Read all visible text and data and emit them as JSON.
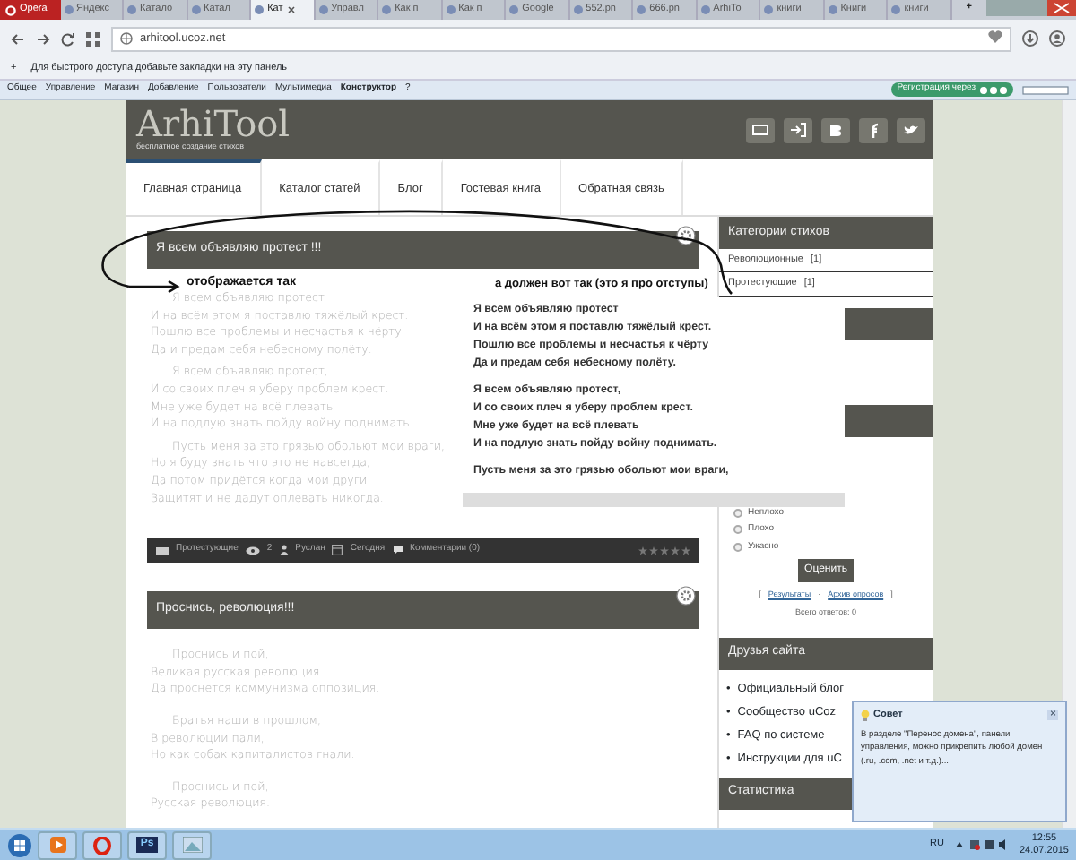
{
  "browser": {
    "menu_label": "Opera",
    "tabs": [
      {
        "label": "Яндекс",
        "selected": false
      },
      {
        "label": "Катало",
        "selected": false
      },
      {
        "label": "Катал",
        "selected": false
      },
      {
        "label": "Кат",
        "selected": true
      },
      {
        "label": "Управл",
        "selected": false
      },
      {
        "label": "Как п",
        "selected": false
      },
      {
        "label": "Как п",
        "selected": false
      },
      {
        "label": "Google",
        "selected": false
      },
      {
        "label": "552.pn",
        "selected": false
      },
      {
        "label": "666.pn",
        "selected": false
      },
      {
        "label": "ArhiTo",
        "selected": false
      },
      {
        "label": "книги",
        "selected": false
      },
      {
        "label": "Книги",
        "selected": false
      },
      {
        "label": "книги",
        "selected": false
      }
    ],
    "new_tab": "+",
    "address": "arhitool.ucoz.net",
    "bookmarks_add": "+",
    "bookmarks_hint": "Для быстрого доступа добавьте закладки на эту панель"
  },
  "admin_bar": {
    "items": [
      {
        "label": "Общее",
        "bold": false
      },
      {
        "label": "Управление",
        "bold": false
      },
      {
        "label": "Магазин",
        "bold": false
      },
      {
        "label": "Добавление",
        "bold": false
      },
      {
        "label": "Пользователи",
        "bold": false
      },
      {
        "label": "Мультимедиа",
        "bold": false
      },
      {
        "label": "Конструктор",
        "bold": true
      },
      {
        "label": "?",
        "bold": false
      }
    ],
    "register": "Регистрация через"
  },
  "site": {
    "logo": "ArhiTool",
    "tagline": "бесплатное создание стихов",
    "nav": [
      {
        "label": "Главная страница",
        "selected": true
      },
      {
        "label": "Каталог статей",
        "selected": false
      },
      {
        "label": "Блог",
        "selected": false
      },
      {
        "label": "Гостевая книга",
        "selected": false
      },
      {
        "label": "Обратная связь",
        "selected": false
      }
    ],
    "posts": [
      {
        "title": "Я всем объявляю протест !!!",
        "note": "отображается так",
        "stanzas": [
          [
            "Я всем объявляю протест",
            "И на всём этом я поставлю тяжёлый крест.",
            "Пошлю все проблемы и несчастья к чёрту",
            "Да и предам себя небесному полёту."
          ],
          [
            "Я всем объявляю протест,",
            "И со своих плеч я уберу проблем крест.",
            "Мне уже будет на всё плевать",
            "И на подлую знать пойду войну поднимать."
          ],
          [
            "Пусть меня за это грязью обольют мои враги,",
            "Но я буду знать что это не навсегда,",
            "Да потом придётся когда мои други",
            "Защитят и не дадут оплевать никогда."
          ]
        ],
        "footer": {
          "category": "Протестующие",
          "views": "2",
          "author": "Руслан",
          "date": "Сегодня",
          "comments": "Комментарии (0)",
          "stars": 0
        }
      },
      {
        "title": "Проснись, революция!!!",
        "stanzas": [
          [
            "Проснись и пой,",
            "Великая русская революция.",
            "Да проснётся коммунизма оппозиция."
          ],
          [
            "Братья наши в прошлом,",
            "В революции пали,",
            "Но как собак капиталистов гнали."
          ],
          [
            "Проснись и пой,",
            "Русская революция."
          ]
        ]
      }
    ],
    "sidebar": {
      "categories_title": "Категории стихов",
      "categories": [
        {
          "label": "Революционные",
          "count": "[1]"
        },
        {
          "label": "Протестующие",
          "count": "[1]"
        }
      ],
      "poll_options": [
        "Неплохо",
        "Плохо",
        "Ужасно"
      ],
      "vote_button": "Оценить",
      "poll_brackets": [
        "[",
        "]"
      ],
      "poll_separator": "·",
      "poll_links": [
        "Результаты",
        "Архив опросов"
      ],
      "friend_bullet": "•",
      "poll_total": "Всего ответов: 0",
      "friends_title": "Друзья сайта",
      "friends": [
        "Официальный блог",
        "Сообщество uCoz",
        "FAQ по системе",
        "Инструкции для uC"
      ],
      "stats_title": "Статистика"
    }
  },
  "correct_example": {
    "title": "а должен вот так (это я про отступы)",
    "stanzas": [
      [
        "Я всем объявляю протест",
        "И на всём этом я поставлю тяжёлый крест.",
        "Пошлю все проблемы и несчастья к чёрту",
        "Да и предам себя небесному полёту."
      ],
      [
        "Я всем объявляю протест,",
        "И со своих плеч я уберу проблем крест.",
        "Мне уже будет на всё плевать",
        "И на подлую знать пойду войну поднимать."
      ],
      [
        "Пусть меня за это грязью обольют мои враги,"
      ]
    ]
  },
  "tip_popup": {
    "title": "Совет",
    "close": "×",
    "text": "В разделе \"Перенос домена\", панели управления, можно прикрепить любой домен (.ru, .com, .net и т.д.)..."
  },
  "taskbar": {
    "app_label": "Ps",
    "language": "RU",
    "time": "12:55",
    "date": "24.07.2015"
  }
}
